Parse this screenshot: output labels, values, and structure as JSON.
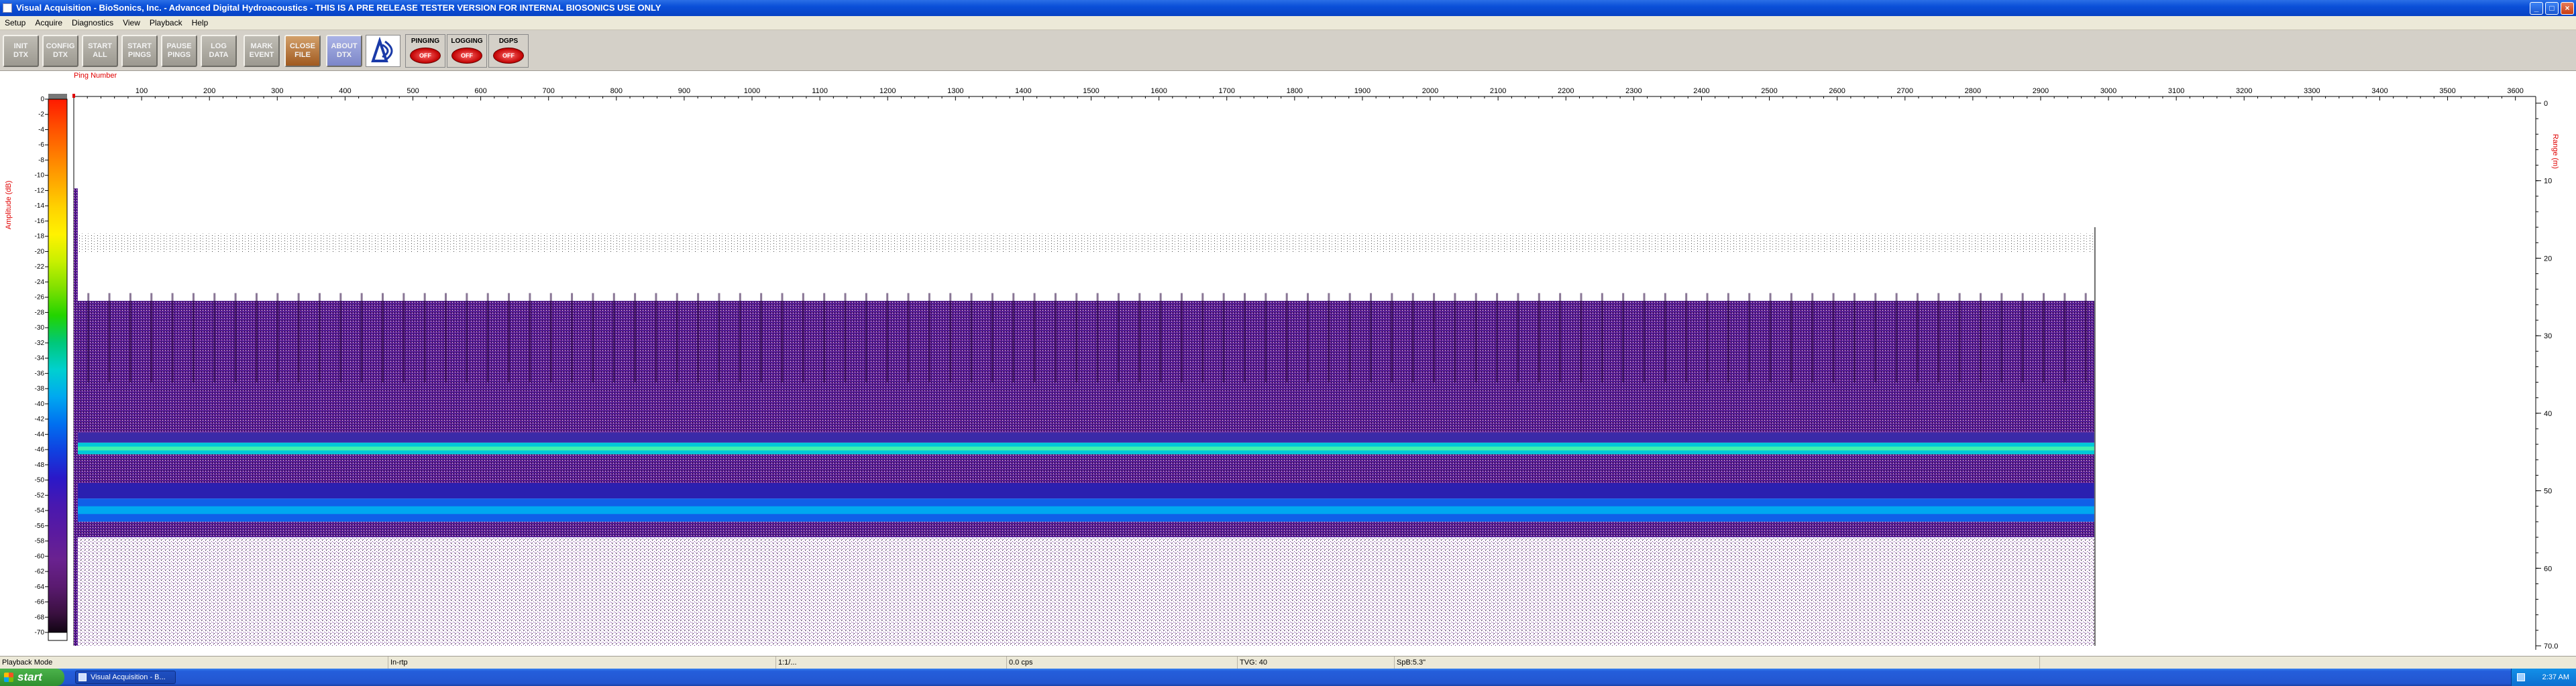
{
  "window": {
    "title": "Visual Acquisition  -  BioSonics, Inc.  -  Advanced Digital Hydroacoustics  -  THIS IS A PRE RELEASE TESTER VERSION FOR INTERNAL BIOSONICS USE ONLY",
    "minimize": "_",
    "maximize": "□",
    "close": "×"
  },
  "menu": [
    "Setup",
    "Acquire",
    "Diagnostics",
    "View",
    "Playback",
    "Help"
  ],
  "toolbar": {
    "buttons": [
      {
        "line1": "INIT",
        "line2": "DTX"
      },
      {
        "line1": "CONFIG",
        "line2": "DTX"
      },
      {
        "line1": "START",
        "line2": "ALL"
      },
      {
        "line1": "START",
        "line2": "PINGS"
      },
      {
        "line1": "PAUSE",
        "line2": "PINGS"
      },
      {
        "line1": "LOG",
        "line2": "DATA"
      },
      {
        "line1": "MARK",
        "line2": "EVENT"
      },
      {
        "line1": "CLOSE",
        "line2": "FILE"
      },
      {
        "line1": "ABOUT",
        "line2": "DTX"
      }
    ],
    "logo": "biosonics-logo",
    "indicators": [
      {
        "label": "PINGING",
        "state": "OFF"
      },
      {
        "label": "LOGGING",
        "state": "OFF"
      },
      {
        "label": "DGPS",
        "state": "OFF"
      }
    ]
  },
  "echogram": {
    "x_axis_title": "Ping Number",
    "x_ticks": [
      100,
      200,
      300,
      400,
      500,
      600,
      700,
      800,
      900,
      1000,
      1100,
      1200,
      1300,
      1400,
      1500,
      1600,
      1700,
      1800,
      1900,
      2000,
      2100,
      2200,
      2300,
      2400,
      2500,
      2600,
      2700,
      2800,
      2900,
      3000,
      3100,
      3200,
      3300,
      3400,
      3500,
      3600
    ],
    "x_range": [
      0,
      3630
    ],
    "data_end_ping": 2980,
    "left_axis_title": "Amplitude (dB)",
    "amplitude_ticks": [
      0,
      -2,
      -4,
      -6,
      -8,
      -10,
      -12,
      -14,
      -16,
      -18,
      -20,
      -22,
      -24,
      -26,
      -28,
      -30,
      -32,
      -34,
      -36,
      -38,
      -40,
      -42,
      -44,
      -46,
      -48,
      -50,
      -52,
      -54,
      -56,
      -58,
      -60,
      -62,
      -64,
      -66,
      -68,
      -70
    ],
    "right_axis_title": "Range (m)",
    "range_ticks": [
      "0",
      "10",
      "20",
      "30",
      "40",
      "50",
      "60",
      "70.0"
    ],
    "range_max": 70,
    "colormap": [
      "#ff1a00",
      "#ff4d00",
      "#ff7a00",
      "#ffa600",
      "#ffd200",
      "#fff200",
      "#c8f000",
      "#7ee000",
      "#22d400",
      "#00c87a",
      "#00d0d0",
      "#00a8f0",
      "#0070f0",
      "#1040e0",
      "#2a18c8",
      "#4818b0",
      "#5a1aa0",
      "#6a2290",
      "#5a1a70",
      "#3a1040",
      "#000000"
    ],
    "bottom_detection_m": 44.5,
    "second_echo_m": 52.5,
    "surface_noise_m": 18
  },
  "status": {
    "mode": "Playback Mode",
    "cells": [
      "In-rtp",
      "1:1/...",
      "0.0 cps",
      "TVG: 40",
      "SpB:5.3\""
    ]
  },
  "taskbar": {
    "start": "start",
    "item": "Visual Acquisition - B...",
    "clock": "2:37 AM"
  }
}
